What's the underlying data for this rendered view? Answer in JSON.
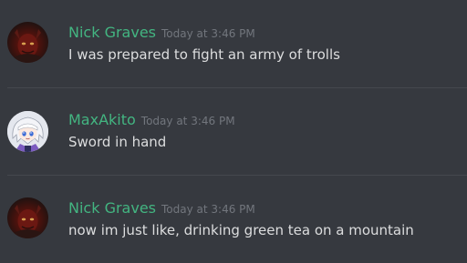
{
  "messages": [
    {
      "username": "Nick Graves",
      "timestamp": "Today at 3:46 PM",
      "text": "I was prepared to fight an army of trolls",
      "avatar_icon": "demon-avatar",
      "name_color": "#43b581"
    },
    {
      "username": "MaxAkito",
      "timestamp": "Today at 3:46 PM",
      "text": "Sword in hand",
      "avatar_icon": "anime-girl-avatar",
      "name_color": "#43b581"
    },
    {
      "username": "Nick Graves",
      "timestamp": "Today at 3:46 PM",
      "text": "now im just like, drinking green tea on a mountain",
      "avatar_icon": "demon-avatar",
      "name_color": "#43b581"
    }
  ],
  "colors": {
    "background": "#36393f",
    "message_text": "#dcddde",
    "timestamp_text": "#72767d",
    "divider": "#45484e"
  }
}
